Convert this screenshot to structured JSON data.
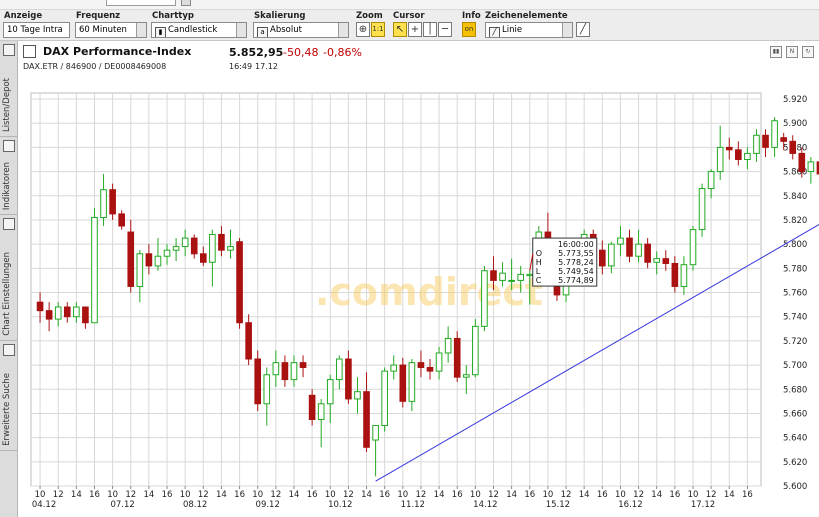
{
  "toolbar": {
    "anzeige": {
      "label": "Anzeige",
      "value": "10 Tage Intra"
    },
    "frequenz": {
      "label": "Frequenz",
      "value": "60 Minuten"
    },
    "charttyp": {
      "label": "Charttyp",
      "value": "Candlestick"
    },
    "skalierung": {
      "label": "Skalierung",
      "value": "Absolut"
    },
    "zoom": {
      "label": "Zoom",
      "btn2": "1:1"
    },
    "cursor": {
      "label": "Cursor"
    },
    "info": {
      "label": "Info",
      "btn": "on"
    },
    "zeichen": {
      "label": "Zeichenelemente",
      "value": "Linie"
    }
  },
  "sidetabs": [
    "Listen/Depot",
    "Indikatoren",
    "Chart Einstellungen",
    "Erweiterte Suche"
  ],
  "header": {
    "name": "DAX Performance-Index",
    "ident": "DAX.ETR / 846900 / DE0008469008",
    "last": "5.852,95",
    "change": "-50,48",
    "change_pct": "-0,86%",
    "time": "16:49",
    "date": "17.12"
  },
  "colors": {
    "up": "#22aa22",
    "down": "#aa1111",
    "trendline": "#3333dd",
    "grid": "#d8d8d8"
  },
  "watermark": ".comdirect",
  "tooltip": {
    "time": "16:00:00",
    "o_label": "O",
    "o": "5.773,55",
    "h_label": "H",
    "h": "5.778,24",
    "l_label": "L",
    "l": "5.749,54",
    "c_label": "C",
    "c": "5.774,89"
  },
  "chart_data": {
    "type": "candlestick",
    "title": "DAX Performance-Index",
    "ylim": [
      5600,
      5920
    ],
    "yticks": [
      "5.920",
      "5.900",
      "5.880",
      "5.860",
      "5.840",
      "5.820",
      "5.800",
      "5.780",
      "5.760",
      "5.740",
      "5.720",
      "5.700",
      "5.680",
      "5.660",
      "5.640",
      "5.620",
      "5.600"
    ],
    "grid": true,
    "hour_labels": [
      "10",
      "12",
      "14",
      "16"
    ],
    "days": [
      "04.12",
      "07.12",
      "08.12",
      "09.12",
      "10.12",
      "11.12",
      "14.12",
      "15.12",
      "16.12",
      "17.12"
    ],
    "candles": [
      [
        5752,
        5760,
        5735,
        5745
      ],
      [
        5745,
        5752,
        5728,
        5738
      ],
      [
        5738,
        5752,
        5732,
        5748
      ],
      [
        5748,
        5752,
        5735,
        5740
      ],
      [
        5740,
        5752,
        5735,
        5748
      ],
      [
        5748,
        5745,
        5730,
        5735
      ],
      [
        5735,
        5830,
        5735,
        5822
      ],
      [
        5822,
        5858,
        5815,
        5845
      ],
      [
        5845,
        5850,
        5820,
        5825
      ],
      [
        5825,
        5828,
        5812,
        5815
      ],
      [
        5810,
        5820,
        5760,
        5765
      ],
      [
        5765,
        5795,
        5752,
        5792
      ],
      [
        5792,
        5800,
        5775,
        5782
      ],
      [
        5782,
        5805,
        5778,
        5790
      ],
      [
        5790,
        5800,
        5783,
        5795
      ],
      [
        5795,
        5805,
        5786,
        5798
      ],
      [
        5798,
        5812,
        5790,
        5805
      ],
      [
        5805,
        5808,
        5788,
        5792
      ],
      [
        5792,
        5798,
        5782,
        5785
      ],
      [
        5785,
        5812,
        5765,
        5808
      ],
      [
        5808,
        5815,
        5790,
        5795
      ],
      [
        5795,
        5812,
        5788,
        5798
      ],
      [
        5802,
        5805,
        5730,
        5735
      ],
      [
        5735,
        5742,
        5700,
        5705
      ],
      [
        5705,
        5712,
        5662,
        5668
      ],
      [
        5668,
        5698,
        5650,
        5692
      ],
      [
        5692,
        5712,
        5682,
        5702
      ],
      [
        5702,
        5708,
        5682,
        5688
      ],
      [
        5688,
        5708,
        5682,
        5702
      ],
      [
        5702,
        5708,
        5690,
        5698
      ],
      [
        5675,
        5680,
        5650,
        5655
      ],
      [
        5655,
        5672,
        5632,
        5668
      ],
      [
        5668,
        5692,
        5652,
        5688
      ],
      [
        5688,
        5708,
        5680,
        5705
      ],
      [
        5705,
        5712,
        5668,
        5672
      ],
      [
        5672,
        5690,
        5660,
        5678
      ],
      [
        5678,
        5694,
        5628,
        5632
      ],
      [
        5638,
        5650,
        5608,
        5650
      ],
      [
        5650,
        5698,
        5645,
        5695
      ],
      [
        5695,
        5708,
        5688,
        5700
      ],
      [
        5700,
        5706,
        5665,
        5670
      ],
      [
        5670,
        5705,
        5662,
        5702
      ],
      [
        5702,
        5712,
        5690,
        5698
      ],
      [
        5698,
        5705,
        5688,
        5695
      ],
      [
        5695,
        5715,
        5688,
        5710
      ],
      [
        5710,
        5732,
        5702,
        5722
      ],
      [
        5722,
        5728,
        5686,
        5690
      ],
      [
        5690,
        5700,
        5676,
        5692
      ],
      [
        5692,
        5738,
        5690,
        5732
      ],
      [
        5732,
        5782,
        5728,
        5778
      ],
      [
        5778,
        5790,
        5762,
        5770
      ],
      [
        5770,
        5785,
        5765,
        5776
      ],
      [
        5770,
        5788,
        5762,
        5770
      ],
      [
        5770,
        5782,
        5760,
        5775
      ],
      [
        5774,
        5778,
        5750,
        5775
      ],
      [
        5775,
        5815,
        5770,
        5810
      ],
      [
        5810,
        5826,
        5778,
        5785
      ],
      [
        5785,
        5800,
        5753,
        5758
      ],
      [
        5758,
        5780,
        5752,
        5776
      ],
      [
        5776,
        5798,
        5770,
        5795
      ],
      [
        5795,
        5812,
        5788,
        5808
      ],
      [
        5808,
        5812,
        5792,
        5795
      ],
      [
        5795,
        5803,
        5775,
        5782
      ],
      [
        5782,
        5802,
        5776,
        5800
      ],
      [
        5800,
        5815,
        5790,
        5805
      ],
      [
        5805,
        5812,
        5785,
        5790
      ],
      [
        5790,
        5812,
        5785,
        5800
      ],
      [
        5800,
        5805,
        5780,
        5785
      ],
      [
        5785,
        5794,
        5775,
        5788
      ],
      [
        5788,
        5795,
        5778,
        5784
      ],
      [
        5784,
        5790,
        5760,
        5765
      ],
      [
        5765,
        5790,
        5758,
        5783
      ],
      [
        5783,
        5815,
        5778,
        5812
      ],
      [
        5812,
        5850,
        5806,
        5846
      ],
      [
        5846,
        5862,
        5838,
        5860
      ],
      [
        5860,
        5898,
        5853,
        5880
      ],
      [
        5880,
        5888,
        5870,
        5878
      ],
      [
        5878,
        5885,
        5865,
        5870
      ],
      [
        5870,
        5880,
        5862,
        5875
      ],
      [
        5875,
        5895,
        5868,
        5890
      ],
      [
        5890,
        5895,
        5872,
        5880
      ],
      [
        5880,
        5905,
        5872,
        5902
      ],
      [
        5888,
        5892,
        5878,
        5885
      ],
      [
        5885,
        5890,
        5870,
        5875
      ],
      [
        5875,
        5880,
        5855,
        5860
      ],
      [
        5860,
        5872,
        5850,
        5868
      ],
      [
        5868,
        5872,
        5853,
        5858
      ],
      [
        5858,
        5868,
        5850,
        5865
      ],
      [
        5865,
        5870,
        5838,
        5842
      ],
      [
        5842,
        5862,
        5836,
        5855
      ]
    ],
    "trendline": {
      "from_index": 37,
      "from_value": 5604,
      "to_index": 90,
      "to_value": 5834
    },
    "tooltip_index": 54
  }
}
